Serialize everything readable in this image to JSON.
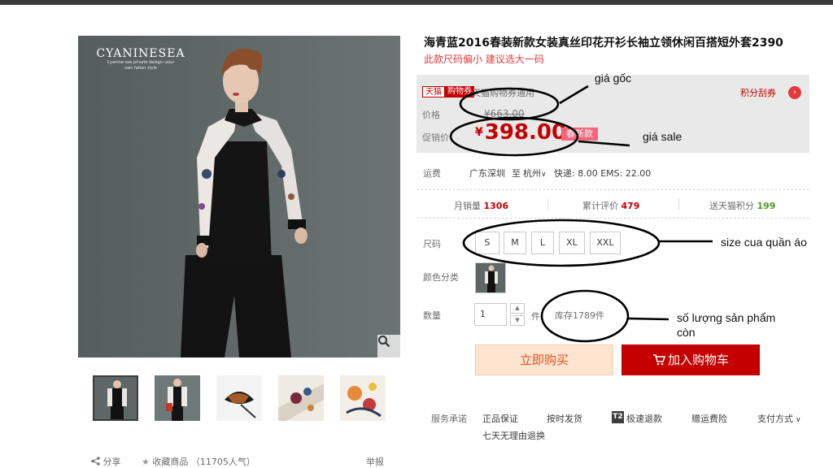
{
  "product": {
    "brand": "CYANINESEA",
    "brand_tagline_1": "Cyanine sea private design--your",
    "brand_tagline_2": "own fation style",
    "title": "海青蓝2016春装新款女装真丝印花开衫长袖立领休闲百搭短外套2390",
    "subtitle": "此款尺码偏小 建议选大一码"
  },
  "price": {
    "badge_store": "天猫",
    "badge_coupon": "购物券",
    "promo_text": "天猫购物券通用",
    "points_link": "积分刮券",
    "points_arrow": "›",
    "original_label": "价格",
    "original_price": "¥663.00",
    "sale_label": "促销价",
    "sale_currency": "¥",
    "sale_price": "398.00",
    "new_tag": "春新款"
  },
  "shipping": {
    "label": "运费",
    "from": "广东深圳",
    "to_label": "至",
    "to": "杭州",
    "detail": "快递: 8.00 EMS: 22.00"
  },
  "stats": {
    "monthly_sales_label": "月销量",
    "monthly_sales": "1306",
    "reviews_label": "累计评价",
    "reviews": "479",
    "points_label": "送天猫积分",
    "points": "199"
  },
  "options": {
    "size_label": "尺码",
    "sizes": [
      "S",
      "M",
      "L",
      "XL",
      "XXL"
    ],
    "color_label": "颜色分类",
    "quantity_label": "数量",
    "quantity_value": "1",
    "quantity_unit": "件",
    "stock": "库存1789件"
  },
  "actions": {
    "buy_now": "立即购买",
    "add_to_cart": "加入购物车"
  },
  "services": {
    "label": "服务承诺",
    "items": [
      "正品保证",
      "按时发货",
      "极速退款",
      "赠运费险"
    ],
    "t2_badge": "T2",
    "payment": "支付方式",
    "return_policy": "七天无理由退换"
  },
  "share_bar": {
    "share": "分享",
    "favorite": "收藏商品",
    "favorite_count": "（11705人气）",
    "report": "举报"
  },
  "annotations": {
    "original_price": "giá gốc",
    "sale_price": "giá sale",
    "size": "size cua quần áo",
    "stock_line1": "số lượng sản phẩm",
    "stock_line2": "còn"
  },
  "colors": {
    "accent_red": "#c40000",
    "price_red": "#c40000",
    "buy_now_bg": "#ffe4d0",
    "annotation_ink": "#000000"
  }
}
